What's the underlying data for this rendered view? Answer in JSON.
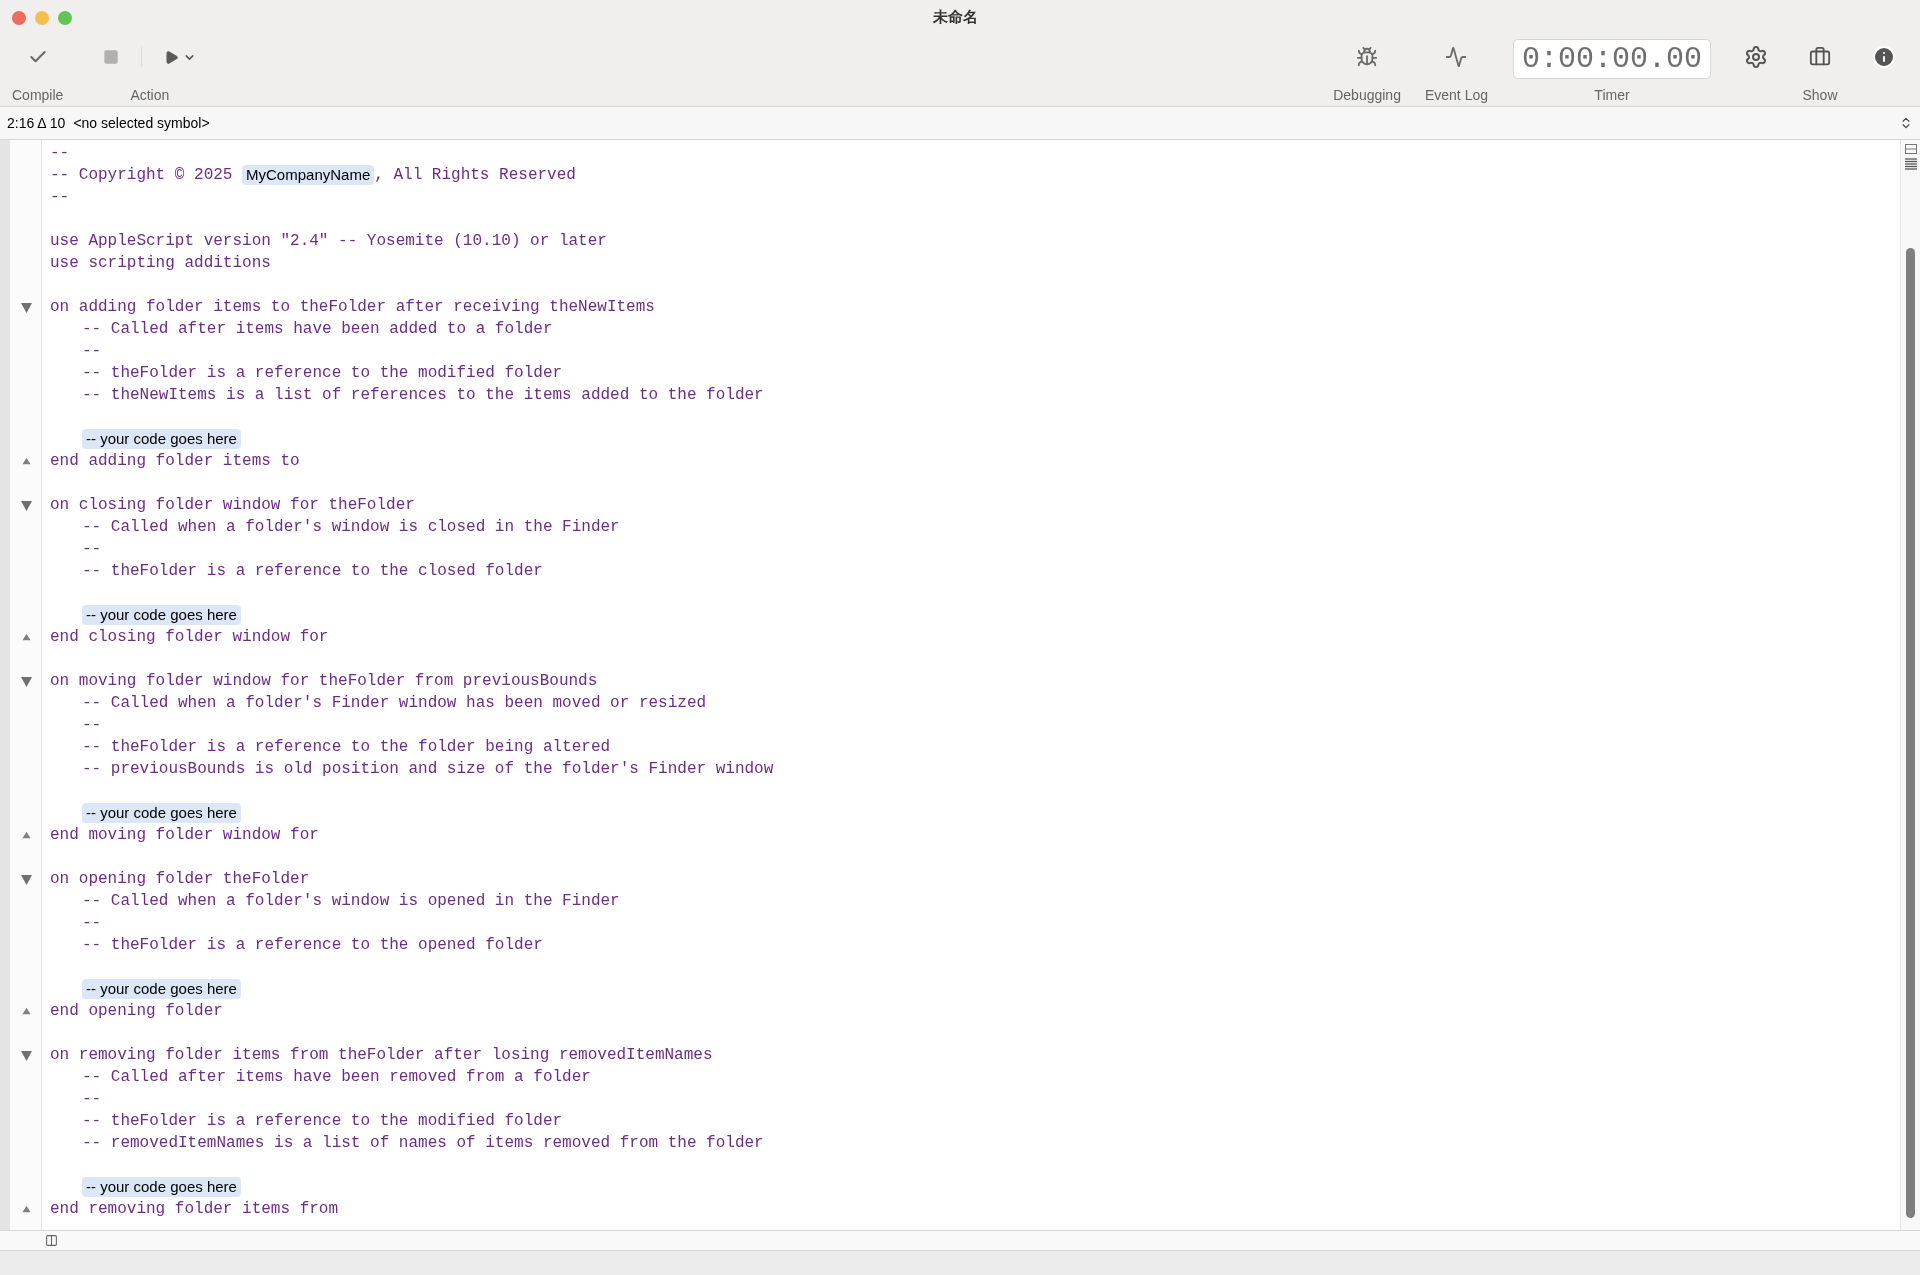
{
  "window": {
    "title": "未命名"
  },
  "toolbar": {
    "left": [
      {
        "kind": "compile",
        "label": "Compile"
      },
      {
        "kind": "action",
        "label": "Action"
      }
    ],
    "right": [
      {
        "kind": "debugging",
        "label": "Debugging"
      },
      {
        "kind": "log",
        "label": "Event Log"
      },
      {
        "kind": "timer",
        "label": "Timer",
        "value": "0:00:00.00"
      },
      {
        "kind": "settings"
      },
      {
        "kind": "show",
        "label": "Show"
      },
      {
        "kind": "info"
      }
    ]
  },
  "navigation": {
    "position": "2:16 Δ 10",
    "symbol": "<no selected symbol>"
  },
  "editor": {
    "lines": [
      {
        "kind": "code",
        "text": "--"
      },
      {
        "kind": "mixed",
        "segments": [
          {
            "kind": "code",
            "text": "-- Copyright © 2025 "
          },
          {
            "kind": "placeholder",
            "text": "MyCompanyName"
          },
          {
            "kind": "code",
            "text": ", All Rights Reserved"
          }
        ]
      },
      {
        "kind": "code",
        "text": "--"
      },
      {
        "kind": "blank"
      },
      {
        "kind": "code",
        "text": "use AppleScript version \"2.4\" -- Yosemite (10.10) or later"
      },
      {
        "kind": "code",
        "text": "use scripting additions"
      },
      {
        "kind": "blank"
      },
      {
        "kind": "handler",
        "text": "on adding folder items to theFolder after receiving theNewItems",
        "expanded": true,
        "end": "end adding folder items to",
        "children": [
          {
            "kind": "code",
            "text": "-- Called after items have been added to a folder"
          },
          {
            "kind": "code",
            "text": "--"
          },
          {
            "kind": "code",
            "text": "-- theFolder is a reference to the modified folder"
          },
          {
            "kind": "code",
            "text": "-- theNewItems is a list of references to the items added to the folder"
          },
          {
            "kind": "blank"
          },
          {
            "kind": "placeholder",
            "text": "-- your code goes here"
          }
        ]
      },
      {
        "kind": "blank"
      },
      {
        "kind": "handler",
        "text": "on closing folder window for theFolder",
        "expanded": true,
        "end": "end closing folder window for",
        "children": [
          {
            "kind": "code",
            "text": "-- Called when a folder's window is closed in the Finder"
          },
          {
            "kind": "code",
            "text": "--"
          },
          {
            "kind": "code",
            "text": "-- theFolder is a reference to the closed folder"
          },
          {
            "kind": "blank"
          },
          {
            "kind": "placeholder",
            "text": "-- your code goes here"
          }
        ]
      },
      {
        "kind": "blank"
      },
      {
        "kind": "handler",
        "text": "on moving folder window for theFolder from previousBounds",
        "expanded": true,
        "end": "end moving folder window for",
        "children": [
          {
            "kind": "code",
            "text": "-- Called when a folder's Finder window has been moved or resized"
          },
          {
            "kind": "code",
            "text": "--"
          },
          {
            "kind": "code",
            "text": "-- theFolder is a reference to the folder being altered"
          },
          {
            "kind": "code",
            "text": "-- previousBounds is old position and size of the folder's Finder window"
          },
          {
            "kind": "blank"
          },
          {
            "kind": "placeholder",
            "text": "-- your code goes here"
          }
        ]
      },
      {
        "kind": "blank"
      },
      {
        "kind": "handler",
        "text": "on opening folder theFolder",
        "expanded": true,
        "end": "end opening folder",
        "children": [
          {
            "kind": "code",
            "text": "-- Called when a folder's window is opened in the Finder"
          },
          {
            "kind": "code",
            "text": "--"
          },
          {
            "kind": "code",
            "text": "-- theFolder is a reference to the opened folder"
          },
          {
            "kind": "blank"
          },
          {
            "kind": "placeholder",
            "text": "-- your code goes here"
          }
        ]
      },
      {
        "kind": "blank"
      },
      {
        "kind": "handler",
        "text": "on removing folder items from theFolder after losing removedItemNames",
        "expanded": true,
        "end": "end removing folder items from",
        "children": [
          {
            "kind": "code",
            "text": "-- Called after items have been removed from a folder"
          },
          {
            "kind": "code",
            "text": "--"
          },
          {
            "kind": "code",
            "text": "-- theFolder is a reference to the modified folder"
          },
          {
            "kind": "code",
            "text": "-- removedItemNames is a list of names of items removed from the folder"
          },
          {
            "kind": "blank"
          },
          {
            "kind": "placeholder",
            "text": "-- your code goes here"
          }
        ]
      }
    ]
  }
}
